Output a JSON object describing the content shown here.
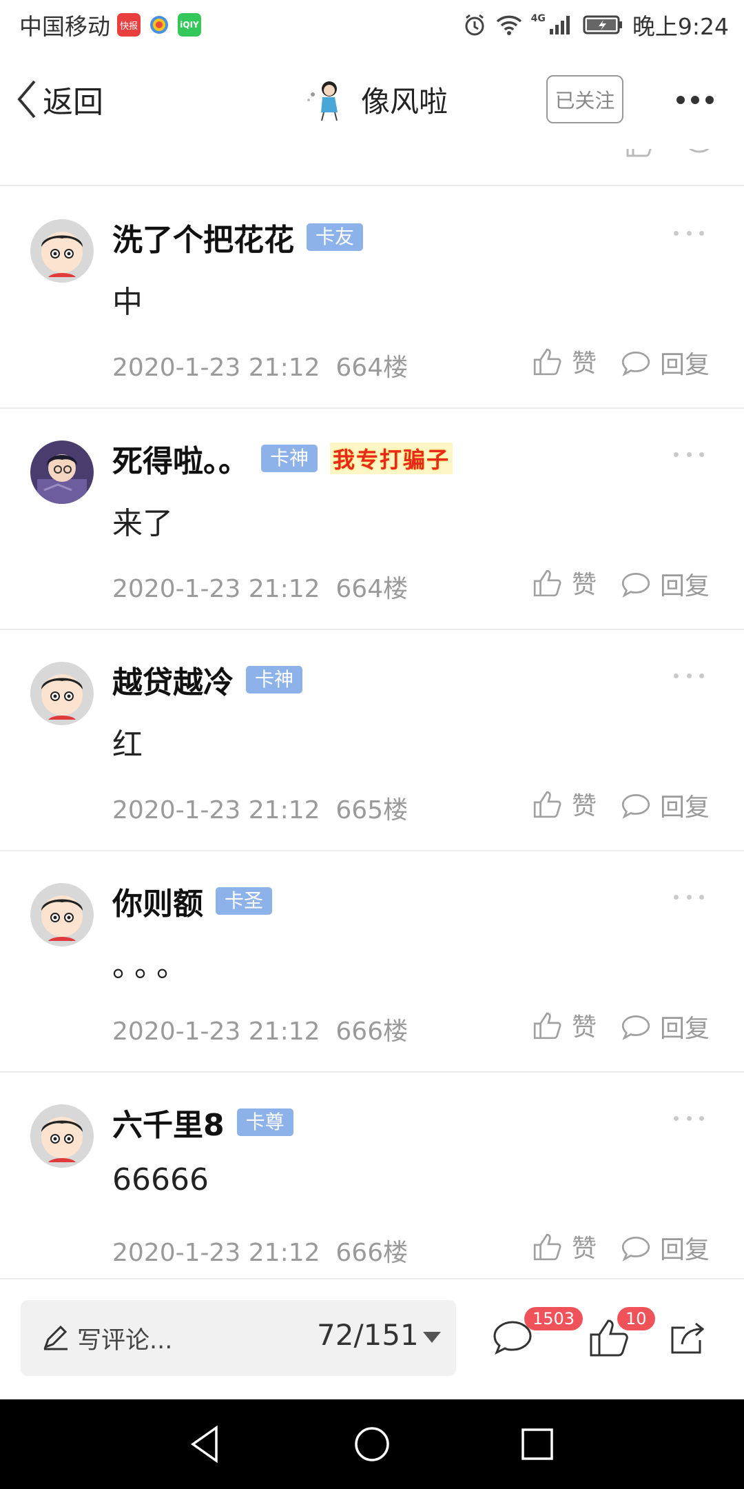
{
  "status_bar": {
    "carrier": "中国移动",
    "time": "晚上9:24",
    "network": "4G",
    "app_icons": [
      "kuaibao-icon",
      "browser-icon",
      "iqiyi-icon"
    ],
    "app_icon_labels": [
      "快报",
      "",
      "iQIY"
    ]
  },
  "nav": {
    "back_label": "返回",
    "title": "像风啦",
    "follow_label": "已关注"
  },
  "comments": [
    {
      "user": "洗了个把花花",
      "badge": "卡友",
      "title_tag": "",
      "text": "中",
      "time": "2020-1-23 21:12",
      "floor": "664楼",
      "like_label": "赞",
      "reply_label": "回复"
    },
    {
      "user": "死得啦。。",
      "badge": "卡神",
      "title_tag": "我专打骗子",
      "text": "来了",
      "time": "2020-1-23 21:12",
      "floor": "664楼",
      "like_label": "赞",
      "reply_label": "回复"
    },
    {
      "user": "越贷越冷",
      "badge": "卡神",
      "title_tag": "",
      "text": "红",
      "time": "2020-1-23 21:12",
      "floor": "665楼",
      "like_label": "赞",
      "reply_label": "回复"
    },
    {
      "user": "你则额",
      "badge": "卡圣",
      "title_tag": "",
      "text": "。。。",
      "time": "2020-1-23 21:12",
      "floor": "666楼",
      "like_label": "赞",
      "reply_label": "回复"
    },
    {
      "user": "六千里8",
      "badge": "卡尊",
      "title_tag": "",
      "text": "66666",
      "time": "2020-1-23 21:12",
      "floor": "666楼",
      "like_label": "赞",
      "reply_label": "回复"
    }
  ],
  "bottom_bar": {
    "input_placeholder": "写评论...",
    "page_counter": "72/151",
    "comment_count": "1503",
    "like_count": "10"
  },
  "colors": {
    "badge_bg": "#8db2ea",
    "count_badge_bg": "#f0525a",
    "meta_text": "#9a9a9a",
    "title_tag_red": "#e8281e"
  }
}
